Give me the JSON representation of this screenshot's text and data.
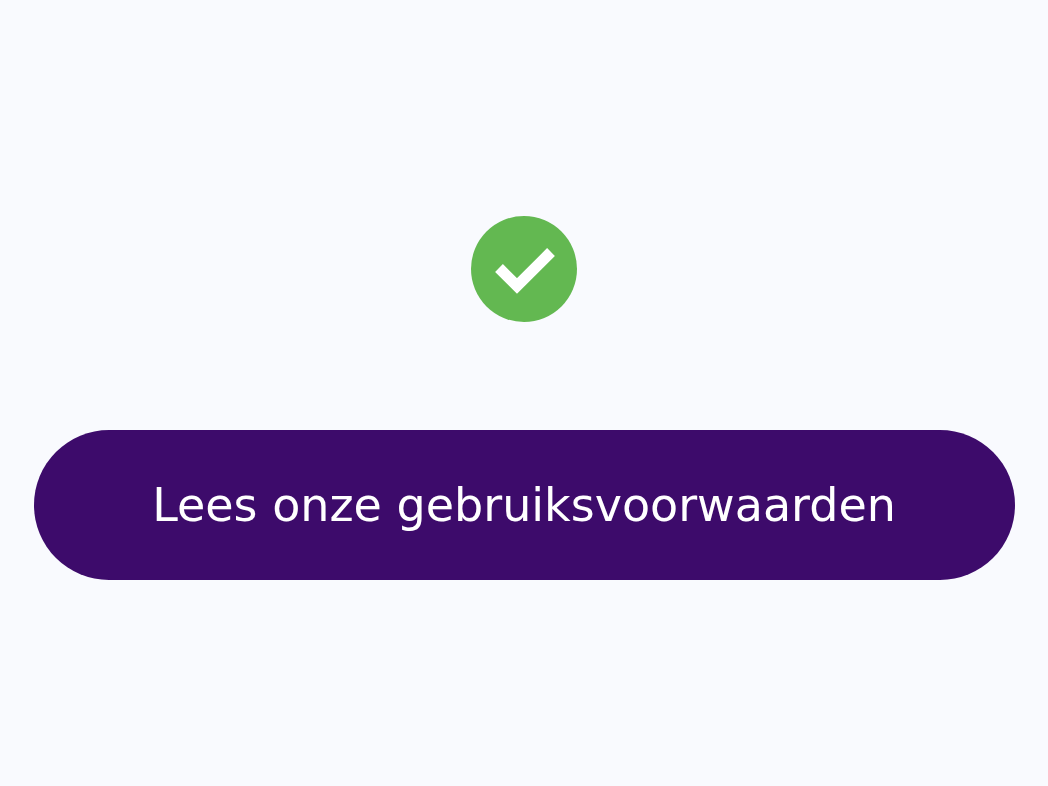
{
  "button": {
    "label": "Lees onze gebruiksvoorwaarden"
  }
}
